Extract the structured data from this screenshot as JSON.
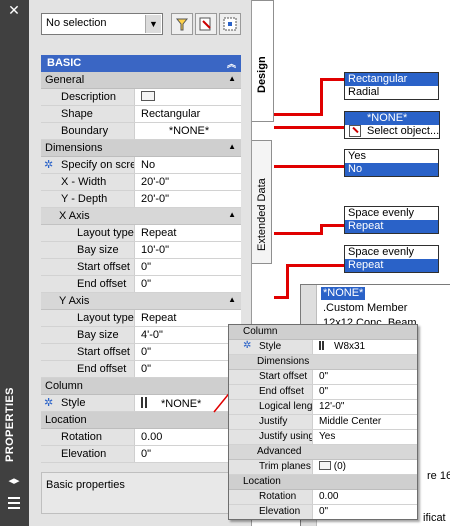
{
  "palette": {
    "title": "PROPERTIES",
    "selection": "No selection",
    "icons": [
      "quick-select-icon",
      "select-objects-icon",
      "toggle-pickadd-icon"
    ],
    "tabs": {
      "design": "Design",
      "extended": "Extended Data"
    },
    "basic_header": "BASIC",
    "general": {
      "label": "General",
      "rows": [
        {
          "key": "Description",
          "value": ""
        },
        {
          "key": "Shape",
          "value": "Rectangular"
        },
        {
          "key": "Boundary",
          "value": "*NONE*"
        }
      ]
    },
    "dimensions": {
      "label": "Dimensions",
      "rows": [
        {
          "key": "Specify on screen",
          "value": "No"
        },
        {
          "key": "X - Width",
          "value": "20'-0\""
        },
        {
          "key": "Y - Depth",
          "value": "20'-0\""
        }
      ],
      "x_axis": {
        "label": "X Axis",
        "rows": [
          {
            "key": "Layout type",
            "value": "Repeat"
          },
          {
            "key": "Bay size",
            "value": "10'-0\""
          },
          {
            "key": "Start offset",
            "value": "0\""
          },
          {
            "key": "End offset",
            "value": "0\""
          }
        ]
      },
      "y_axis": {
        "label": "Y Axis",
        "rows": [
          {
            "key": "Layout type",
            "value": "Repeat"
          },
          {
            "key": "Bay size",
            "value": "4'-0\""
          },
          {
            "key": "Start offset",
            "value": "0\""
          },
          {
            "key": "End offset",
            "value": "0\""
          }
        ]
      }
    },
    "column": {
      "label": "Column",
      "rows": [
        {
          "key": "Style",
          "value": "*NONE*"
        }
      ]
    },
    "location": {
      "label": "Location",
      "rows": [
        {
          "key": "Rotation",
          "value": "0.00"
        },
        {
          "key": "Elevation",
          "value": "0\""
        }
      ]
    },
    "description_text": "Basic properties"
  },
  "callouts": {
    "shape": {
      "options": [
        "Rectangular",
        "Radial"
      ],
      "selected": "Rectangular"
    },
    "boundary": {
      "options": [
        "*NONE*",
        "Select object..."
      ],
      "selected": "*NONE*"
    },
    "specify": {
      "options": [
        "Yes",
        "No"
      ],
      "selected": "No"
    },
    "x_layout": {
      "options": [
        "Space evenly",
        "Repeat"
      ],
      "selected": "Repeat"
    },
    "y_layout": {
      "options": [
        "Space evenly",
        "Repeat"
      ],
      "selected": "Repeat"
    }
  },
  "style_list": {
    "items": [
      "*NONE*",
      ".Custom Member",
      "12x12 Conc. Beam"
    ],
    "selected": "*NONE*",
    "partial": [
      "re 16",
      "ificat"
    ]
  },
  "mini_palette": {
    "column": {
      "label": "Column",
      "rows": [
        {
          "key": "Style",
          "value": "W8x31"
        }
      ]
    },
    "dimensions": {
      "label": "Dimensions",
      "rows": [
        {
          "key": "Start offset",
          "value": "0\""
        },
        {
          "key": "End offset",
          "value": "0\""
        },
        {
          "key": "Logical length",
          "value": "12'-0\""
        },
        {
          "key": "Justify",
          "value": "Middle Center"
        },
        {
          "key": "Justify using...",
          "value": "Yes"
        }
      ]
    },
    "advanced": {
      "label": "Advanced",
      "rows": [
        {
          "key": "Trim planes",
          "value": "(0)"
        }
      ]
    },
    "location": {
      "label": "Location",
      "rows": [
        {
          "key": "Rotation",
          "value": "0.00"
        },
        {
          "key": "Elevation",
          "value": "0\""
        }
      ]
    }
  },
  "colors": {
    "section_header": "#3a66c4",
    "callout_line": "#e00000",
    "selection": "#2a62c8",
    "title_strip": "#404040"
  }
}
